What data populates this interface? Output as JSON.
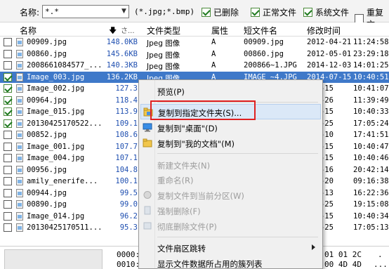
{
  "filter": {
    "name_label": "名称:",
    "name_value": "*.*",
    "ext_text": "(*.jpg;*.bmp)",
    "checks": [
      {
        "label": "已删除",
        "checked": true
      },
      {
        "label": "正常文件",
        "checked": true
      },
      {
        "label": "系统文件",
        "checked": true
      },
      {
        "label": "重复文",
        "checked": false
      }
    ]
  },
  "columns": {
    "name": "名称",
    "size": "さ...",
    "type": "文件类型",
    "attr": "属性",
    "short": "短文件名",
    "modified": "修改时间"
  },
  "rows": [
    {
      "checked": false,
      "name": "00909.jpg",
      "size": "148.0KB",
      "type": "Jpeg 图像",
      "attr": "A",
      "short": "00909.jpg",
      "date": "2012-04-21",
      "time": "11:24:58"
    },
    {
      "checked": false,
      "name": "00860.jpg",
      "size": "145.6KB",
      "type": "Jpeg 图像",
      "attr": "A",
      "short": "00860.jpg",
      "date": "2012-05-01",
      "time": "23:29:18"
    },
    {
      "checked": false,
      "name": "2008661084577_...",
      "size": "140.3KB",
      "type": "Jpeg 图像",
      "attr": "A",
      "short": "200866~1.JPG",
      "date": "2014-12-03",
      "time": "14:01:25"
    },
    {
      "checked": true,
      "name": "Image_003.jpg",
      "size": "136.2KB",
      "type": "Jpeg 图像",
      "attr": "A",
      "short": "IMAGE_~4.JPG",
      "date": "2014-07-15",
      "time": "10:40:51",
      "selected": true
    },
    {
      "checked": true,
      "name": "Image_002.jpg",
      "size": "127.3",
      "type": "",
      "attr": "",
      "short": "",
      "date": "-07-15",
      "time": "10:41:07"
    },
    {
      "checked": true,
      "name": "00964.jpg",
      "size": "118.4",
      "type": "",
      "attr": "",
      "short": "",
      "date": "-04-26",
      "time": "11:39:49"
    },
    {
      "checked": true,
      "name": "Image_015.jpg",
      "size": "113.9",
      "type": "",
      "attr": "",
      "short": "",
      "date": "-07-15",
      "time": "10:40:33"
    },
    {
      "checked": true,
      "name": "20130425170522...",
      "size": "109.1",
      "type": "",
      "attr": "",
      "short": "",
      "date": "-04-25",
      "time": "17:05:24"
    },
    {
      "checked": false,
      "name": "00852.jpg",
      "size": "108.6",
      "type": "",
      "attr": "",
      "short": "",
      "date": "-04-10",
      "time": "17:41:51"
    },
    {
      "checked": false,
      "name": "Image_001.jpg",
      "size": "107.7",
      "type": "",
      "attr": "",
      "short": "",
      "date": "-07-15",
      "time": "10:40:47"
    },
    {
      "checked": false,
      "name": "Image_004.jpg",
      "size": "107.1",
      "type": "",
      "attr": "",
      "short": "",
      "date": "-07-15",
      "time": "10:40:46"
    },
    {
      "checked": false,
      "name": "00956.jpg",
      "size": "104.8",
      "type": "",
      "attr": "",
      "short": "",
      "date": "-05-16",
      "time": "20:42:14"
    },
    {
      "checked": false,
      "name": "amily_enerife...",
      "size": "100.1",
      "type": "",
      "attr": "",
      "short": "",
      "date": "-03-20",
      "time": "09:16:38"
    },
    {
      "checked": false,
      "name": "00944.jpg",
      "size": "99.5",
      "type": "",
      "attr": "",
      "short": "",
      "date": "-12-13",
      "time": "16:22:36"
    },
    {
      "checked": false,
      "name": "00890.jpg",
      "size": "99.0",
      "type": "",
      "attr": "",
      "short": "",
      "date": "-03-25",
      "time": "19:15:08"
    },
    {
      "checked": false,
      "name": "Image_014.jpg",
      "size": "96.2",
      "type": "",
      "attr": "",
      "short": "",
      "date": "-07-15",
      "time": "10:40:34"
    },
    {
      "checked": false,
      "name": "20130425170511...",
      "size": "95.3",
      "type": "",
      "attr": "",
      "short": "",
      "date": "-04-25",
      "time": "17:05:13"
    }
  ],
  "hex": {
    "addr1": "0000:",
    "addr2": "0010:",
    "bytes1": "01 01 2C",
    "bytes2": "00 4D 4D",
    "tail1": ".",
    "tail2": "..."
  },
  "menu": {
    "items": [
      {
        "label": "预览(P)",
        "disabled": false,
        "icon": "none"
      },
      {
        "label": "复制到指定文件夹(S)...",
        "disabled": false,
        "icon": "copy-folder-icon",
        "highlighted": true
      },
      {
        "label": "复制到\"桌面\"(D)",
        "disabled": false,
        "icon": "desktop-icon"
      },
      {
        "label": "复制到\"我的文档\"(M)",
        "disabled": false,
        "icon": "documents-folder-icon"
      },
      {
        "label": "新建文件夹(N)",
        "disabled": true,
        "icon": "none"
      },
      {
        "label": "重命名(R)",
        "disabled": true,
        "icon": "none"
      },
      {
        "label": "复制文件到当前分区(W)",
        "disabled": true,
        "icon": "copy-partition-icon"
      },
      {
        "label": "强制删除(F)",
        "disabled": true,
        "icon": "force-delete-icon"
      },
      {
        "label": "彻底删除文件(P)",
        "disabled": true,
        "icon": "shred-icon"
      },
      {
        "label": "文件扇区跳转",
        "disabled": false,
        "icon": "none",
        "submenu": true
      },
      {
        "label": "显示文件数据所占用的簇列表",
        "disabled": false,
        "icon": "none"
      }
    ]
  },
  "colors": {
    "selection": "#3f79c9",
    "highlight_border": "#e02020",
    "size_text": "#1f4fb0"
  }
}
